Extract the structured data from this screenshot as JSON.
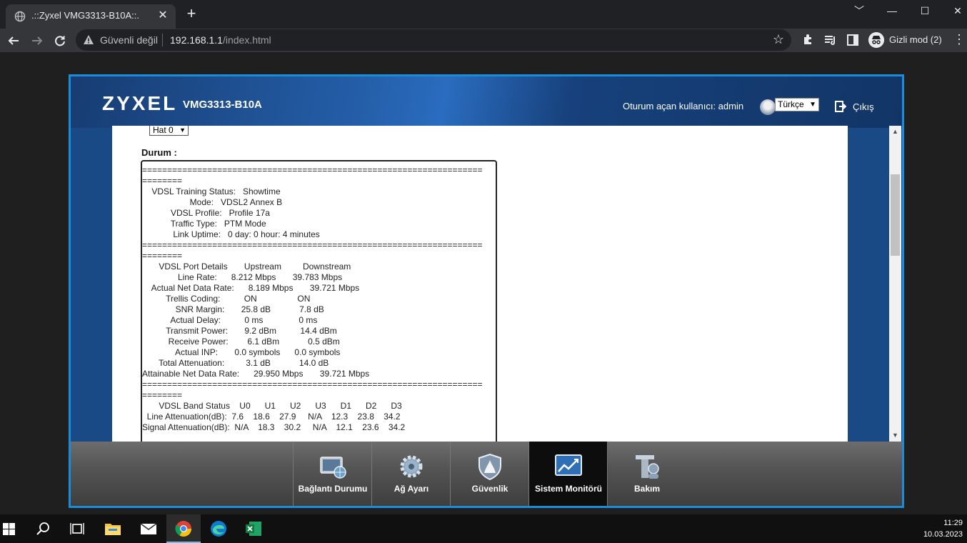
{
  "browser": {
    "tab_title": ".::Zyxel VMG3313-B10A::.",
    "tab_close": "✕",
    "new_tab": "+",
    "insecure_label": "Güvenli değil",
    "url_host": "192.168.1.1",
    "url_path": "/index.html",
    "incognito_label": "Gizli mod (2)",
    "window_controls": [
      "﹀",
      "—",
      "☐",
      "✕"
    ]
  },
  "router": {
    "brand": "ZYXEL",
    "model": "VMG3313-B10A",
    "user_label": "Oturum açan kullanıcı: admin",
    "language": "Türkçe",
    "logout_label": "Çıkış",
    "line_select": "Hat 0",
    "status_label": "Durum :",
    "status_text": "====================================================================\n========\n    VDSL Training Status:   Showtime\n                    Mode:   VDSL2 Annex B\n            VDSL Profile:   Profile 17a\n            Traffic Type:   PTM Mode\n             Link Uptime:   0 day: 0 hour: 4 minutes\n====================================================================\n========\n       VDSL Port Details       Upstream         Downstream\n               Line Rate:      8.212 Mbps       39.783 Mbps\n    Actual Net Data Rate:      8.189 Mbps       39.721 Mbps\n          Trellis Coding:          ON                 ON\n              SNR Margin:       25.8 dB            7.8 dB\n            Actual Delay:          0 ms               0 ms\n          Transmit Power:       9.2 dBm          14.4 dBm\n           Receive Power:        6.1 dBm            0.5 dBm\n              Actual INP:       0.0 symbols      0.0 symbols\n       Total Attenuation:         3.1 dB            14.0 dB\nAttainable Net Data Rate:      29.950 Mbps       39.721 Mbps\n====================================================================\n========\n       VDSL Band Status    U0      U1      U2      U3      D1      D2      D3\n  Line Attenuation(dB):  7.6    18.6    27.9     N/A    12.3    23.8    34.2\nSignal Attenuation(dB):  N/A    18.3    30.2     N/A    12.1    23.6    34.2",
    "nav": [
      {
        "label": "Bağlantı Durumu",
        "icon": "connection-status-icon"
      },
      {
        "label": "Ağ Ayarı",
        "icon": "gear-icon"
      },
      {
        "label": "Güvenlik",
        "icon": "shield-icon"
      },
      {
        "label": "Sistem Monitörü",
        "icon": "monitor-chart-icon",
        "active": true
      },
      {
        "label": "Bakım",
        "icon": "maintenance-icon"
      }
    ]
  },
  "taskbar": {
    "time": "11:29",
    "date": "10.03.2023"
  },
  "colors": {
    "router_accent": "#1a8cd8",
    "header_blue": "#245ea8",
    "chrome_dark": "#202124"
  }
}
